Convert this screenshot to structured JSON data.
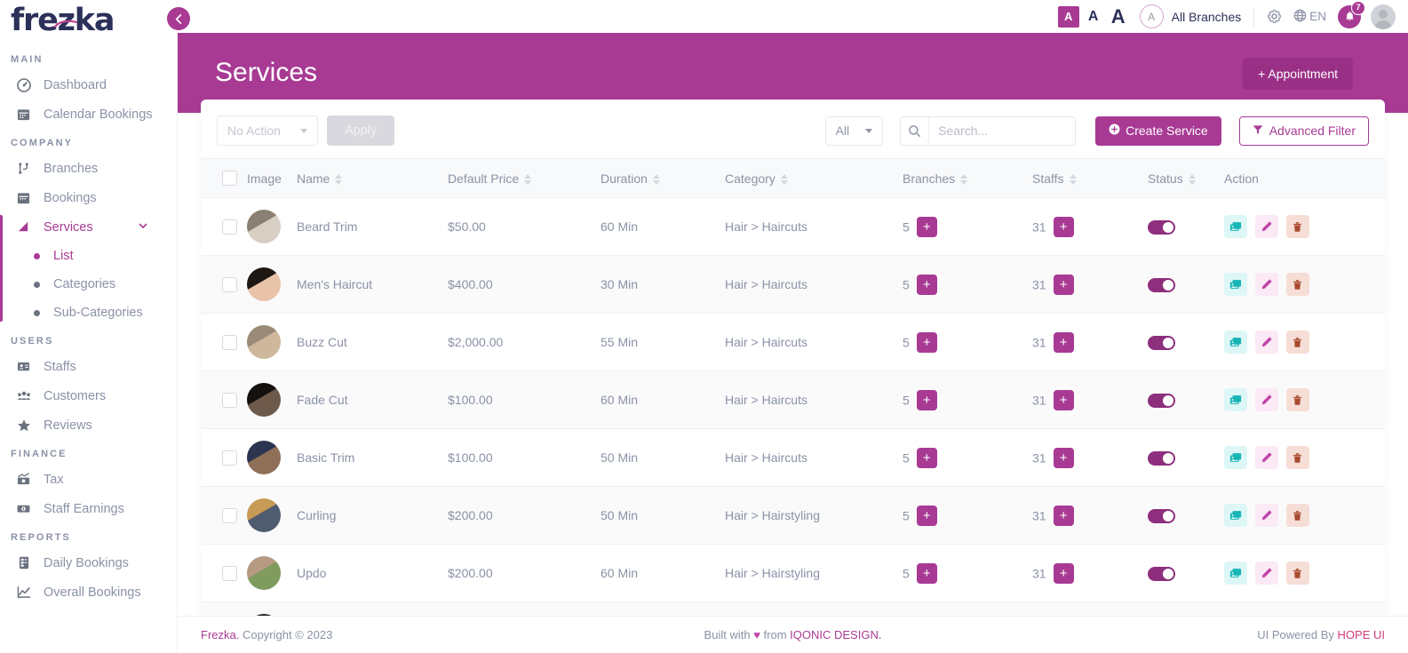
{
  "brand": {
    "logo": "frezka",
    "accent": "#a83a94"
  },
  "topbar": {
    "font_small": "A",
    "font_medium": "A",
    "font_large": "A",
    "branch_initial": "A",
    "branch_label": "All Branches",
    "settings_icon": "gear-icon",
    "language": "EN",
    "notification_count": "7"
  },
  "sidebar": {
    "sections": [
      {
        "title": "MAIN",
        "items": [
          {
            "label": "Dashboard",
            "icon": "dashboard-icon",
            "active": false
          },
          {
            "label": "Calendar Bookings",
            "icon": "calendar-icon",
            "active": false
          }
        ]
      },
      {
        "title": "COMPANY",
        "items": [
          {
            "label": "Branches",
            "icon": "branches-icon",
            "active": false
          },
          {
            "label": "Bookings",
            "icon": "bookings-icon",
            "active": false
          },
          {
            "label": "Services",
            "icon": "services-icon",
            "active": true,
            "children": [
              {
                "label": "List",
                "active": true
              },
              {
                "label": "Categories",
                "active": false
              },
              {
                "label": "Sub-Categories",
                "active": false
              }
            ]
          }
        ]
      },
      {
        "title": "USERS",
        "items": [
          {
            "label": "Staffs",
            "icon": "staff-card-icon",
            "active": false
          },
          {
            "label": "Customers",
            "icon": "customers-icon",
            "active": false
          },
          {
            "label": "Reviews",
            "icon": "star-icon",
            "active": false
          }
        ]
      },
      {
        "title": "FINANCE",
        "items": [
          {
            "label": "Tax",
            "icon": "tax-icon",
            "active": false
          },
          {
            "label": "Staff Earnings",
            "icon": "money-icon",
            "active": false
          }
        ]
      },
      {
        "title": "REPORTS",
        "items": [
          {
            "label": "Daily Bookings",
            "icon": "report-doc-icon",
            "active": false
          },
          {
            "label": "Overall Bookings",
            "icon": "chart-line-icon",
            "active": false
          }
        ]
      }
    ]
  },
  "page": {
    "title": "Services",
    "appointment_button": "+ Appointment"
  },
  "toolbar": {
    "bulk_action_value": "No Action",
    "apply_label": "Apply",
    "filter_select_value": "All",
    "search_placeholder": "Search...",
    "search_value": "",
    "create_label": "Create Service",
    "advanced_filter_label": "Advanced Filter"
  },
  "table": {
    "columns": [
      {
        "label": "",
        "sortable": false
      },
      {
        "label": "Image",
        "sortable": false
      },
      {
        "label": "Name",
        "sortable": true
      },
      {
        "label": "Default Price",
        "sortable": true
      },
      {
        "label": "Duration",
        "sortable": true
      },
      {
        "label": "Category",
        "sortable": true
      },
      {
        "label": "Branches",
        "sortable": true
      },
      {
        "label": "Staffs",
        "sortable": true
      },
      {
        "label": "Status",
        "sortable": true
      },
      {
        "label": "Action",
        "sortable": false
      }
    ],
    "rows": [
      {
        "name": "Beard Trim",
        "price": "$50.00",
        "duration": "60 Min",
        "category": "Hair > Haircuts",
        "branches": "5",
        "staffs": "31",
        "status": true,
        "thumb_a": "#8a7f72",
        "thumb_b": "#d8cfc4"
      },
      {
        "name": "Men's Haircut",
        "price": "$400.00",
        "duration": "30 Min",
        "category": "Hair > Haircuts",
        "branches": "5",
        "staffs": "31",
        "status": true,
        "thumb_a": "#1d1814",
        "thumb_b": "#e8c3a8"
      },
      {
        "name": "Buzz Cut",
        "price": "$2,000.00",
        "duration": "55 Min",
        "category": "Hair > Haircuts",
        "branches": "5",
        "staffs": "31",
        "status": true,
        "thumb_a": "#9a8b78",
        "thumb_b": "#cfb79c"
      },
      {
        "name": "Fade Cut",
        "price": "$100.00",
        "duration": "60 Min",
        "category": "Hair > Haircuts",
        "branches": "5",
        "staffs": "31",
        "status": true,
        "thumb_a": "#14110f",
        "thumb_b": "#6e5a4a"
      },
      {
        "name": "Basic Trim",
        "price": "$100.00",
        "duration": "50 Min",
        "category": "Hair > Haircuts",
        "branches": "5",
        "staffs": "31",
        "status": true,
        "thumb_a": "#2b3550",
        "thumb_b": "#8f6f58"
      },
      {
        "name": "Curling",
        "price": "$200.00",
        "duration": "50 Min",
        "category": "Hair > Hairstyling",
        "branches": "5",
        "staffs": "31",
        "status": true,
        "thumb_a": "#c79a56",
        "thumb_b": "#4f5b6e"
      },
      {
        "name": "Updo",
        "price": "$200.00",
        "duration": "60 Min",
        "category": "Hair > Hairstyling",
        "branches": "5",
        "staffs": "31",
        "status": true,
        "thumb_a": "#b79a82",
        "thumb_b": "#7f9b5e"
      },
      {
        "name": "",
        "price": "",
        "duration": "",
        "category": "",
        "branches": "",
        "staffs": "",
        "status": false,
        "thumb_a": "#2a211c",
        "thumb_b": "#e3bfa4"
      }
    ],
    "action_icons": {
      "gallery": "gallery-icon",
      "edit": "pencil-icon",
      "delete": "trash-icon"
    }
  },
  "footer": {
    "left_brand": "Frezka.",
    "left_text": " Copyright © 2023",
    "center_prefix": "Built with ",
    "center_heart": "♥",
    "center_mid": " from ",
    "center_link": "IQONIC DESIGN.",
    "right_text": "UI Powered By ",
    "right_link": "HOPE UI"
  }
}
